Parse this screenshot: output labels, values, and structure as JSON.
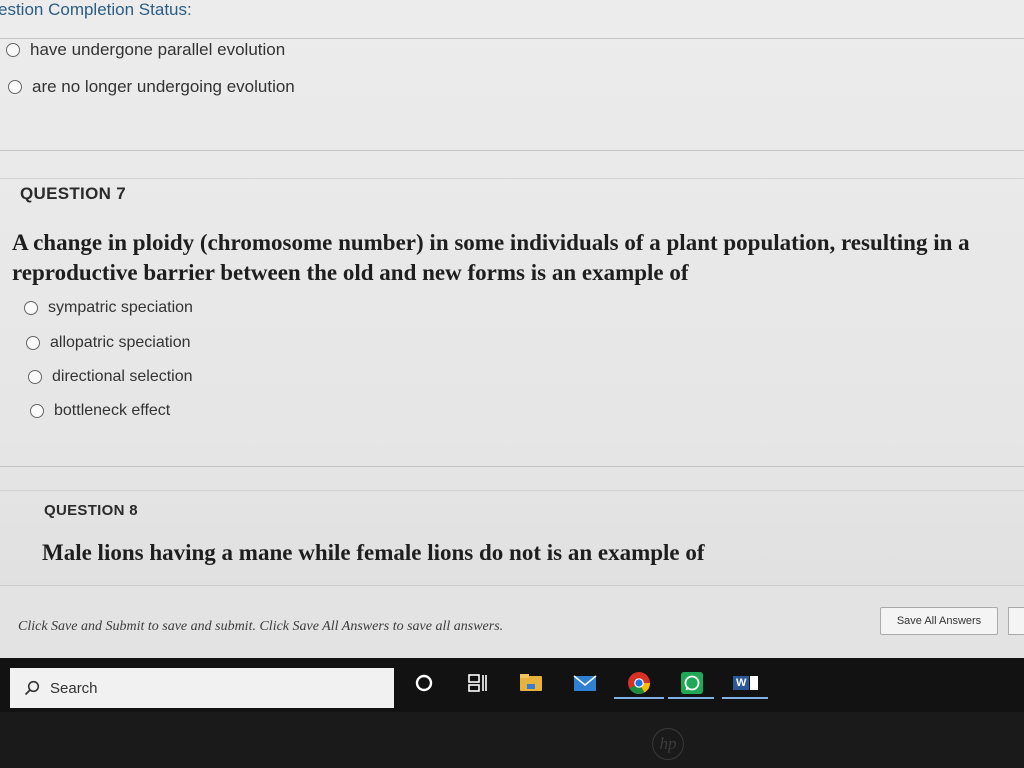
{
  "header": {
    "status_label": "estion Completion Status:"
  },
  "question6": {
    "options": [
      "have undergone  parallel evolution",
      "are no longer undergoing evolution"
    ]
  },
  "question7": {
    "label": "QUESTION 7",
    "text_line1": "A change in ploidy (chromosome number) in some individuals of a plant population, resulting in a",
    "text_line2": "reproductive barrier between the old and new forms is an example of",
    "options": [
      "sympatric speciation",
      "allopatric speciation",
      "directional selection",
      "bottleneck effect"
    ]
  },
  "question8": {
    "label": "QUESTION 8",
    "text": "Male lions having a mane while female lions do not is an example of"
  },
  "footer": {
    "note": "Click Save and Submit to save and submit. Click Save All Answers to save all answers.",
    "save_all_label": "Save All Answers"
  },
  "taskbar": {
    "search_label": "Search",
    "icons": [
      "cortana-circle-icon",
      "task-view-icon",
      "file-explorer-icon",
      "mail-icon",
      "chrome-icon",
      "whatsapp-icon",
      "word-icon"
    ],
    "word_letter": "W"
  },
  "bezel": {
    "brand": "hp"
  }
}
